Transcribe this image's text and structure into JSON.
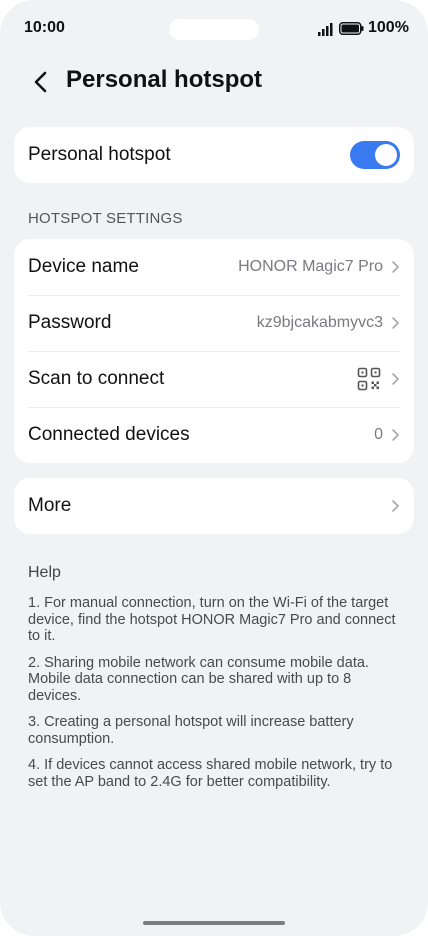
{
  "status_bar": {
    "time": "10:00",
    "battery": "100%"
  },
  "header": {
    "title": "Personal hotspot"
  },
  "hotspot_toggle": {
    "label": "Personal hotspot",
    "on": true
  },
  "settings": {
    "section_label": "HOTSPOT SETTINGS",
    "device_name": {
      "label": "Device name",
      "value": "HONOR Magic7 Pro"
    },
    "password": {
      "label": "Password",
      "value": "kz9bjcakabmyvc3"
    },
    "scan": {
      "label": "Scan to connect"
    },
    "connected": {
      "label": "Connected devices",
      "value": "0"
    }
  },
  "more": {
    "label": "More"
  },
  "help": {
    "title": "Help",
    "items": [
      "1. For manual connection, turn on the Wi-Fi of the target device, find the hotspot HONOR Magic7 Pro and connect to it.",
      "2. Sharing mobile network can consume mobile data. Mobile data connection can be shared with up to 8 devices.",
      "3. Creating a personal hotspot will increase battery consumption.",
      "4. If devices cannot access shared mobile network, try to set the AP band to 2.4G for better compatibility."
    ]
  },
  "colors": {
    "accent": "#3a7af0",
    "background": "#f1f2f4",
    "card": "#ffffff"
  }
}
